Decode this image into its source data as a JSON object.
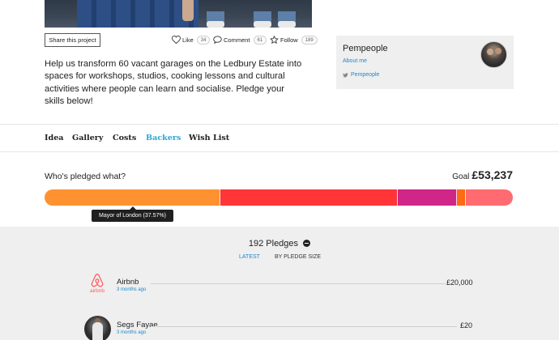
{
  "actions": {
    "share_label": "Share this project",
    "like": {
      "label": "Like",
      "count": "34"
    },
    "comment": {
      "label": "Comment",
      "count": "61"
    },
    "follow": {
      "label": "Follow",
      "count": "189"
    }
  },
  "description": "Help us transform 60 vacant garages on the Ledbury Estate into spaces for workshops, studios, cooking lessons and cultural activities where people can learn and socialise. Pledge your skills below!",
  "sidebar": {
    "org_name": "Pempeople",
    "about_link": "About me",
    "twitter_handle": "Pempeople"
  },
  "tabs": [
    {
      "label": "Idea",
      "active": false
    },
    {
      "label": "Gallery",
      "active": false
    },
    {
      "label": "Costs",
      "active": false
    },
    {
      "label": "Backers",
      "active": true
    },
    {
      "label": "Wish List",
      "active": false
    }
  ],
  "pledges": {
    "heading": "Who's pledged what?",
    "goal_label": "Goal",
    "goal_amount": "£53,237",
    "tooltip": "Mayor of London (37.57%)",
    "segments": [
      {
        "share": 37.57,
        "color": "#ff9230"
      },
      {
        "share": 38.0,
        "color": "#ff3538"
      },
      {
        "share": 12.5,
        "color": "#cf2687"
      },
      {
        "share": 2.0,
        "color": "#ff6a12"
      },
      {
        "share": 10.0,
        "color": "#ff6b70"
      }
    ]
  },
  "backers": {
    "count_label": "192 Pledges",
    "sort_latest": "LATEST",
    "sort_size": "BY PLEDGE SIZE",
    "items": [
      {
        "name": "Airbnb",
        "logo_text": "airbnb",
        "time": "3 months ago",
        "amount": "£20,000"
      },
      {
        "name": "Segs Fayae",
        "time": "3 months ago",
        "amount": "£20"
      }
    ]
  }
}
